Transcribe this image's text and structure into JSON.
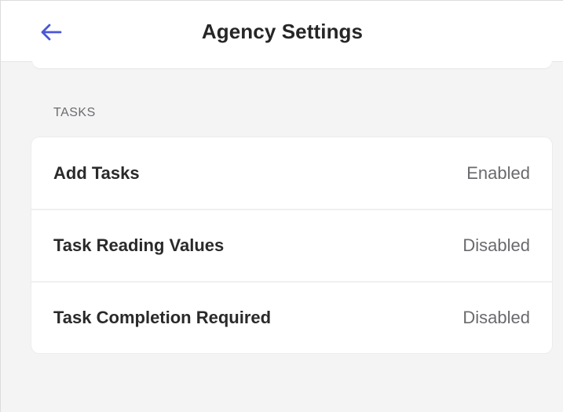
{
  "header": {
    "title": "Agency Settings",
    "back_icon": "arrow-left-icon",
    "accent_color": "#4a56d6"
  },
  "tasks_section": {
    "label": "TASKS",
    "rows": [
      {
        "label": "Add Tasks",
        "value": "Enabled"
      },
      {
        "label": "Task Reading Values",
        "value": "Disabled"
      },
      {
        "label": "Task Completion Required",
        "value": "Disabled"
      }
    ]
  }
}
